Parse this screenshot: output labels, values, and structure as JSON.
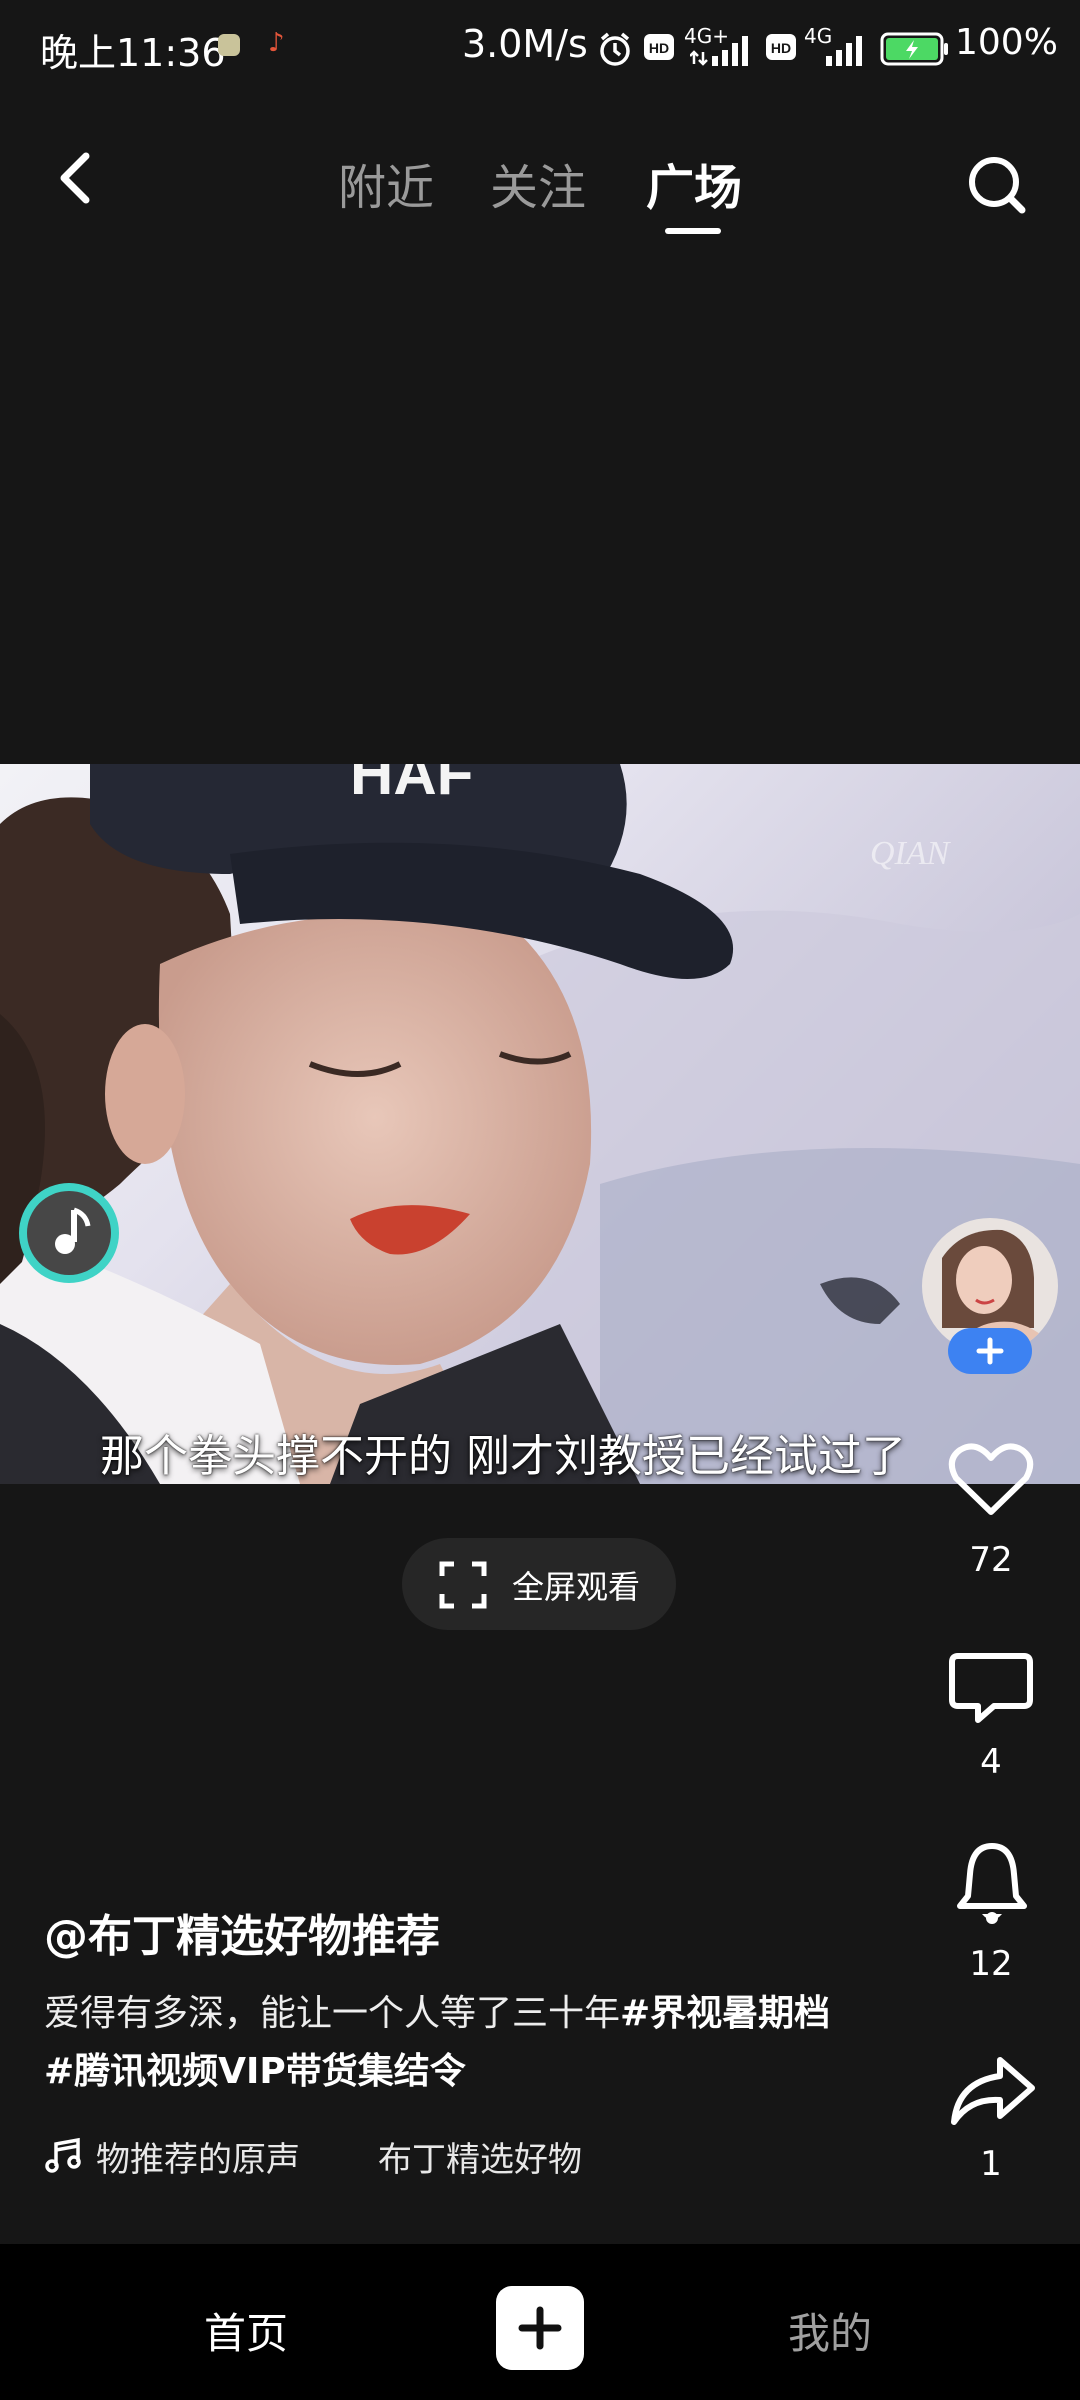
{
  "status_bar": {
    "time": "晚上11:36",
    "speed": "3.0M/s",
    "network1": "4G+",
    "network2": "4G",
    "battery": "100%"
  },
  "top_nav": {
    "tabs": [
      {
        "label": "附近",
        "active": false
      },
      {
        "label": "关注",
        "active": false
      },
      {
        "label": "广场",
        "active": true
      }
    ]
  },
  "video": {
    "subtitle": "那个拳头撑不开的 刚才刘教授已经试过了",
    "watermark": "QIAN",
    "cap_text": "HAF"
  },
  "fullscreen_label": "全屏观看",
  "actions": {
    "likes": "72",
    "comments": "4",
    "notifications": "12",
    "shares": "1"
  },
  "post": {
    "author": "@布丁精选好物推荐",
    "caption_text": "爱得有多深，能让一个人等了三十年",
    "hashtag1": "#界视暑期档",
    "hashtag2": "#腾讯视频VIP带货集结令",
    "music_part1": "物推荐的原声",
    "music_part2": "布丁精选好物"
  },
  "bottom_nav": {
    "home": "首页",
    "me": "我的"
  },
  "colors": {
    "background": "#161616",
    "accent_blue": "#3d82f2",
    "disc_ring": "#3fd3c6"
  }
}
